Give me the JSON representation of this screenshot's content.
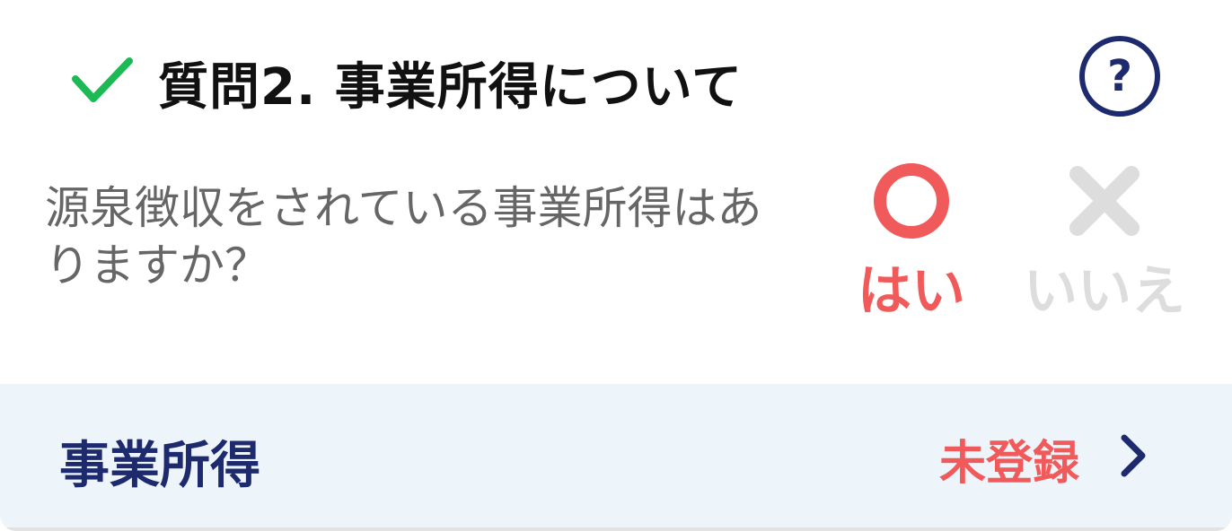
{
  "header": {
    "title": "質問2. 事業所得について",
    "help_symbol": "?"
  },
  "question": {
    "text": "源泉徴収をされている事業所得はありますか？"
  },
  "answers": {
    "yes_label": "はい",
    "no_label": "いいえ"
  },
  "footer": {
    "section_name": "事業所得",
    "status": "未登録"
  },
  "colors": {
    "check": "#1db954",
    "navy": "#1e2a6e",
    "accent_red": "#f05a5a",
    "disabled_gray": "#dddddd",
    "footer_bg": "#eef5fa"
  },
  "icons": {
    "header": "check-icon",
    "help": "question-circle-icon",
    "yes": "circle-icon",
    "no": "cross-icon",
    "footer": "chevron-right-icon"
  }
}
